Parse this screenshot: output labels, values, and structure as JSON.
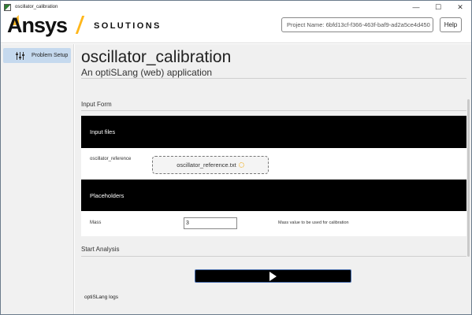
{
  "window": {
    "title": "oscillator_calibration",
    "controls": {
      "minimize": "—",
      "maximize": "☐",
      "close": "✕"
    }
  },
  "header": {
    "brand": "Ansys",
    "division": "SOLUTIONS",
    "project_name": "Project Name: 6bfd13cf-f366-463f-baf9-ad2a5ce4d450",
    "help_label": "Help",
    "brand_accent_color": "#ffb71b"
  },
  "sidebar": {
    "items": [
      {
        "label": "Problem Setup",
        "icon": "sliders-icon",
        "active": true
      }
    ]
  },
  "main": {
    "title": "oscillator_calibration",
    "subtitle": "An optiSLang (web) application",
    "input_form": {
      "section_label": "Input Form",
      "input_files": {
        "header": "Input files",
        "field_label": "oscillator_reference",
        "file_name": "oscillator_reference.txt"
      },
      "placeholders": {
        "header": "Placeholders",
        "field_label": "Mass",
        "value": "3",
        "description": "Mass value to be used for calibration"
      }
    },
    "start_analysis": {
      "section_label": "Start Analysis",
      "button_icon": "play-icon"
    },
    "logs_label": "optiSLang logs"
  }
}
